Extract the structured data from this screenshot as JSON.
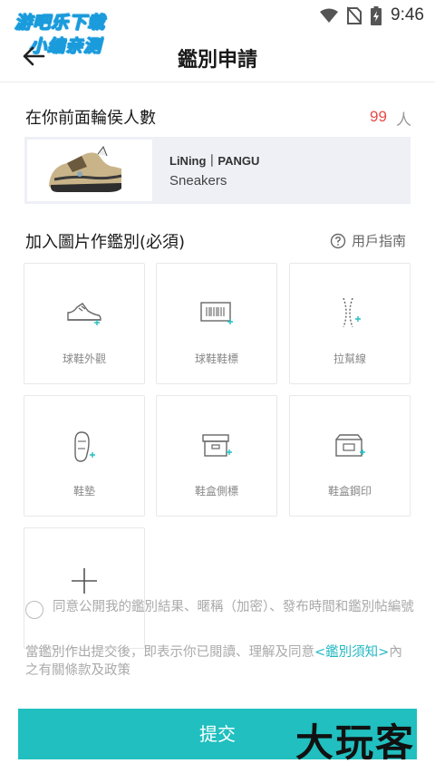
{
  "status_bar": {
    "time": "9:46"
  },
  "watermark": {
    "line1": "游吧乐下载",
    "line2": "小编亲测",
    "bottom": "大玩客"
  },
  "header": {
    "title": "鑑別申請"
  },
  "queue": {
    "label": "在你前面輪侯人數",
    "count": "99",
    "unit": "人"
  },
  "product": {
    "brand": "LiNing｜PANGU",
    "category": "Sneakers"
  },
  "photos": {
    "label": "加入圖片作鑑別(必須)",
    "guide": "用戶指南",
    "tiles": [
      {
        "label": "球鞋外觀",
        "icon": "sneaker-icon"
      },
      {
        "label": "球鞋鞋標",
        "icon": "barcode-tag-icon"
      },
      {
        "label": "拉幫線",
        "icon": "stitch-line-icon"
      },
      {
        "label": "鞋墊",
        "icon": "insole-icon"
      },
      {
        "label": "鞋盒側標",
        "icon": "box-side-label-icon"
      },
      {
        "label": "鞋盒鋼印",
        "icon": "box-stamp-icon"
      }
    ]
  },
  "agreement": {
    "text": "同意公開我的鑑別結果、暱稱（加密）、發布時間和鑑別帖編號"
  },
  "notice": {
    "prefix": "當鑑別作出提交後，即表示你已閱讀、理解及同意",
    "link": "<鑑別須知>",
    "suffix": "內之有關條款及政策"
  },
  "submit": {
    "label": "提交"
  },
  "colors": {
    "accent": "#21bfbf",
    "count_red": "#e84a4a",
    "card_bg": "#eef0f6"
  }
}
